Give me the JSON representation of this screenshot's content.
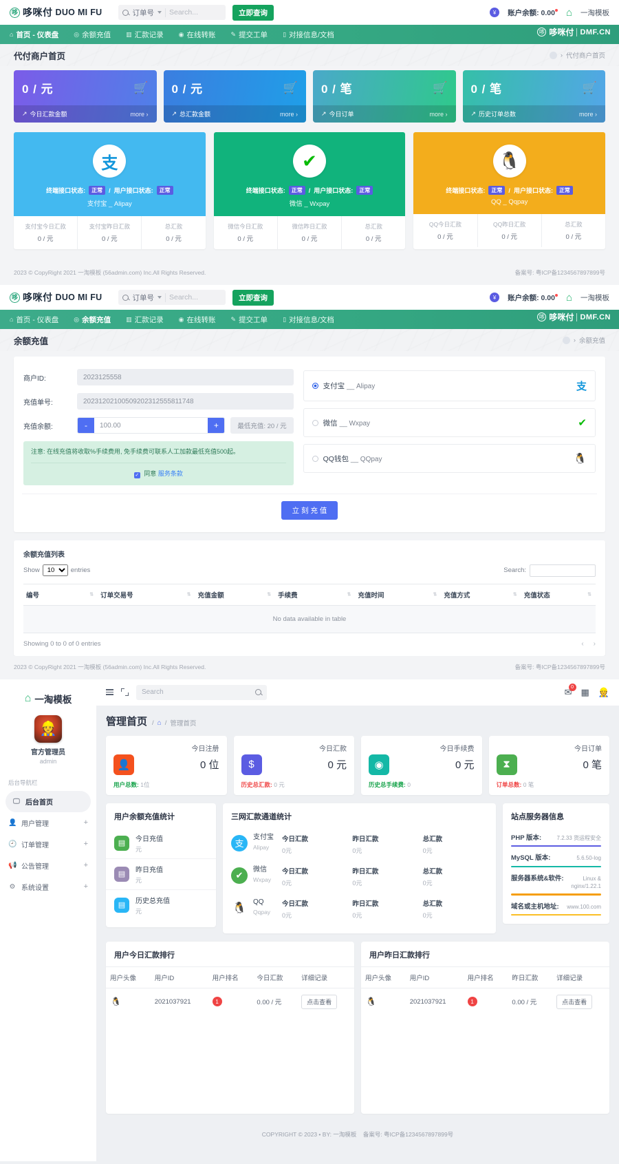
{
  "site": {
    "brand": {
      "mark": "哆",
      "cn": "哆咪付",
      "en": "DUO MI FU"
    },
    "search": {
      "select_label": "订单号",
      "placeholder": "Search...",
      "button": "立即查询"
    },
    "account": {
      "balance_label": "账户余额:",
      "balance_value": "0.00",
      "user": "一淘模板"
    },
    "nav_logo": {
      "cn": "哆咪付",
      "en": "DMF.CN"
    },
    "nav": [
      {
        "icon": "home-icon",
        "label": "首页 - 仪表盘"
      },
      {
        "icon": "wallet-icon",
        "label": "余额充值"
      },
      {
        "icon": "chart-icon",
        "label": "汇款记录"
      },
      {
        "icon": "transfer-icon",
        "label": "在线转账"
      },
      {
        "icon": "ticket-icon",
        "label": "提交工单"
      },
      {
        "icon": "doc-icon",
        "label": "对接信息/文档"
      }
    ],
    "footer": {
      "copyright": "2023 © CopyRight 2021 一淘模板 (56admin.com)  Inc.All Rights Reserved.",
      "icp": "备案号: 粤ICP备1234567897899号"
    }
  },
  "home": {
    "title": "代付商户首页",
    "breadcrumb": "代付商户首页",
    "cards": [
      {
        "value": "0 / 元",
        "label": "今日汇款金额",
        "more": "more ›",
        "theme": "g1"
      },
      {
        "value": "0 / 元",
        "label": "总汇款金额",
        "more": "more ›",
        "theme": "g2"
      },
      {
        "value": "0 / 笔",
        "label": "今日订单",
        "more": "more ›",
        "theme": "g3"
      },
      {
        "value": "0 / 笔",
        "label": "历史订单总数",
        "more": "more ›",
        "theme": "g4"
      }
    ],
    "channels": [
      {
        "theme": "chan-alipay",
        "glyph": "支",
        "terminal_label": "终端接口状态:",
        "terminal_status": "正常",
        "user_label": "用户接口状态:",
        "user_status": "正常",
        "name": "支付宝 _ Alipay",
        "stats": [
          {
            "label": "支付宝今日汇款",
            "value": "0 / 元"
          },
          {
            "label": "支付宝昨日汇款",
            "value": "0 / 元"
          },
          {
            "label": "总汇款",
            "value": "0 / 元"
          }
        ]
      },
      {
        "theme": "chan-wx",
        "glyph": "✔",
        "terminal_label": "终端接口状态:",
        "terminal_status": "正常",
        "user_label": "用户接口状态:",
        "user_status": "正常",
        "name": "微信 _ Wxpay",
        "stats": [
          {
            "label": "微信今日汇款",
            "value": "0 / 元"
          },
          {
            "label": "微信昨日汇款",
            "value": "0 / 元"
          },
          {
            "label": "总汇款",
            "value": "0 / 元"
          }
        ]
      },
      {
        "theme": "chan-qq",
        "glyph": "🐧",
        "terminal_label": "终端接口状态:",
        "terminal_status": "正常",
        "user_label": "用户接口状态:",
        "user_status": "正常",
        "name": "QQ _ Qqpay",
        "stats": [
          {
            "label": "QQ今日汇款",
            "value": "0 / 元"
          },
          {
            "label": "QQ昨日汇款",
            "value": "0 / 元"
          },
          {
            "label": "总汇款",
            "value": "0 / 元"
          }
        ]
      }
    ]
  },
  "recharge": {
    "title": "余额充值",
    "breadcrumb": "余额充值",
    "fields": {
      "merchant_id_label": "商户ID:",
      "merchant_id_value": "2023125558",
      "order_no_label": "充值单号:",
      "order_no_value": "20231202100509202312555811748",
      "amount_label": "充值余额:",
      "amount_value": "100.00",
      "minus": "-",
      "plus": "+",
      "min_note": "最低充值: 20 / 元"
    },
    "notice": {
      "text": "注意: 在线充值将收取%手续费用, 免手续费可联系人工加款最低充值500起。",
      "agree": "同意",
      "terms": "服务条款"
    },
    "methods": [
      {
        "label": "支付宝",
        "sub": "__ Alipay",
        "icon": "alipay-icon",
        "selected": true
      },
      {
        "label": "微信",
        "sub": "__ Wxpay",
        "icon": "wechat-icon",
        "selected": false
      },
      {
        "label": "QQ钱包",
        "sub": "__ QQpay",
        "icon": "qq-icon",
        "selected": false
      }
    ],
    "submit": "立 刻 充 值",
    "table": {
      "title": "余额充值列表",
      "show_prefix": "Show",
      "show_value": "10",
      "show_suffix": "entries",
      "search_label": "Search:",
      "search_value": "",
      "columns": [
        "编号",
        "订单交易号",
        "充值金额",
        "手续费",
        "充值时间",
        "充值方式",
        "充值状态"
      ],
      "empty_text": "No data available in table",
      "info": "Showing 0 to 0 of 0 entries",
      "prev": "‹",
      "next": "›"
    }
  },
  "admin": {
    "sidebar": {
      "brand": "一淘模板",
      "user_name": "官方管理员",
      "user_role": "admin",
      "group_title": "后台导航栏",
      "items": [
        {
          "icon": "monitor-icon",
          "label": "后台首页",
          "active": true,
          "expandable": false
        },
        {
          "icon": "user-icon",
          "label": "用户管理",
          "active": false,
          "expandable": true
        },
        {
          "icon": "order-icon",
          "label": "订单管理",
          "active": false,
          "expandable": true
        },
        {
          "icon": "megaphone-icon",
          "label": "公告管理",
          "active": false,
          "expandable": true
        },
        {
          "icon": "settings-icon",
          "label": "系统设置",
          "active": false,
          "expandable": true
        }
      ]
    },
    "header": {
      "search_placeholder": "Search",
      "mail_count": "0"
    },
    "page_title": "管理首页",
    "breadcrumb": "管理首页",
    "stats": [
      {
        "title": "今日注册",
        "value": "0 位",
        "icon": "person-icon",
        "color": "#f4511e",
        "sub_label": "用户总数:",
        "sub_value": "1位",
        "sub_color": "#16a34a",
        "sub_icon": "users-icon"
      },
      {
        "title": "今日汇款",
        "value": "0 元",
        "icon": "dollar-icon",
        "color": "#5b5ce2",
        "sub_label": "历史总汇款:",
        "sub_value": "0 元",
        "sub_color": "#ef4444",
        "sub_icon": "dollar-icon"
      },
      {
        "title": "今日手续费",
        "value": "0 元",
        "icon": "coin-icon",
        "color": "#14b8a6",
        "sub_label": "历史总手续费:",
        "sub_value": "0",
        "sub_color": "#16a34a",
        "sub_icon": "coin-icon"
      },
      {
        "title": "今日订单",
        "value": "0 笔",
        "icon": "hourglass-icon",
        "color": "#4caf50",
        "sub_label": "订单总数:",
        "sub_value": "0 笔",
        "sub_color": "#ef4444",
        "sub_icon": "hourglass-icon"
      }
    ],
    "balance_card": {
      "title": "用户余额充值统计",
      "items": [
        {
          "label": "今日充值",
          "value": "元",
          "color": "#4caf50",
          "icon": "recharge-icon"
        },
        {
          "label": "昨日充值",
          "value": "元",
          "color": "#9b8bb4",
          "icon": "recharge-icon"
        },
        {
          "label": "历史总充值",
          "value": "元",
          "color": "#29b6f6",
          "icon": "recharge-icon"
        }
      ]
    },
    "channel_card": {
      "title": "三网汇款通道统计",
      "headers": [
        "今日汇款",
        "昨日汇款",
        "总汇款"
      ],
      "rows": [
        {
          "name": "支付宝",
          "en": "Alipay",
          "glyph": "支",
          "color": "#29b6f6",
          "values": [
            "0元",
            "0元",
            "0元"
          ]
        },
        {
          "name": "微信",
          "en": "Wxpay",
          "glyph": "✔",
          "color": "#4caf50",
          "values": [
            "0元",
            "0元",
            "0元"
          ]
        },
        {
          "name": "QQ",
          "en": "Qqpay",
          "glyph": "🐧",
          "color": "#ffffff",
          "values": [
            "0元",
            "0元",
            "0元"
          ]
        }
      ]
    },
    "server_card": {
      "title": "站点服务器信息",
      "items": [
        {
          "key": "PHP 版本:",
          "value": "7.2.33 货运程安全",
          "bar": "#5b5ce2"
        },
        {
          "key": "MySQL 版本:",
          "value": "5.6.50-log",
          "bar": "#14b8a6"
        },
        {
          "key": "服务器系统&软件:",
          "value": "Linux & nginx/1.22.1",
          "bar": "#f59e0b"
        },
        {
          "key": "域名或主机地址:",
          "value": "www.100.com",
          "bar": "#fbbf24"
        }
      ]
    },
    "rank_today": {
      "title": "用户今日汇款排行",
      "columns": [
        "用户头像",
        "用户ID",
        "用户排名",
        "今日汇款",
        "详细记录"
      ],
      "rows": [
        {
          "avatar": "🐧",
          "uid": "2021037921",
          "rank": "1",
          "amount": "0.00 / 元",
          "action": "点击查看"
        }
      ]
    },
    "rank_yesterday": {
      "title": "用户昨日汇款排行",
      "columns": [
        "用户头像",
        "用户ID",
        "用户排名",
        "昨日汇款",
        "详细记录"
      ],
      "rows": [
        {
          "avatar": "🐧",
          "uid": "2021037921",
          "rank": "1",
          "amount": "0.00 / 元",
          "action": "点击查看"
        }
      ]
    },
    "footer": {
      "text": "COPYRIGHT © 2023  •  BY: 一淘模板",
      "icp": "备案号: 粤ICP备1234567897899号"
    }
  }
}
